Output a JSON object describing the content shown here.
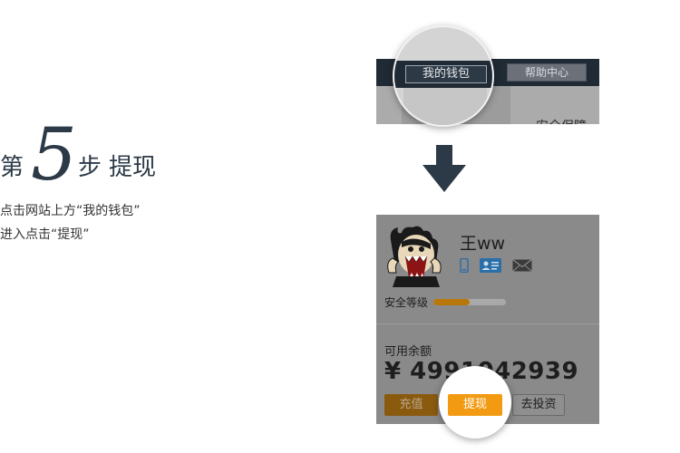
{
  "step": {
    "prefix": "第",
    "number": "5",
    "suffix": "步",
    "name": "提现",
    "desc_line1": "点击网站上方“我的钱包”",
    "desc_line2": "进入点击“提现”"
  },
  "top_nav": {
    "wallet_label": "我的钱包",
    "help_label": "帮助中心",
    "cut_text": "安全保障"
  },
  "account": {
    "username": "王ww",
    "security_label": "安全等级",
    "security_level": 0.5,
    "balance_label": "可用余额",
    "balance": "¥ 4991042939",
    "charge_label": "充值",
    "withdraw_label": "提现",
    "invest_label": "去投资"
  },
  "icons": [
    "phone-icon",
    "id-card-icon",
    "mail-icon",
    "down-arrow-icon"
  ],
  "colors": {
    "dark_navy": "#2c3a47",
    "accent_orange": "#f29a11"
  }
}
